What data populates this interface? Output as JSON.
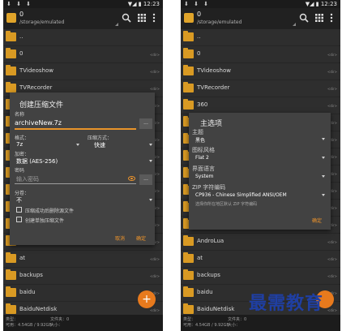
{
  "status": {
    "left_icons": "⬇ ⬇ ⬇",
    "right": "▼◢ ▮ 12:23"
  },
  "appbar": {
    "title": "0",
    "path": "/storage/emulated",
    "grid_glyph": "⋮⋮",
    "menu_glyph": "⋮"
  },
  "files": [
    {
      "name": "..",
      "tag": ""
    },
    {
      "name": "0",
      "tag": "<dir>"
    },
    {
      "name": "TVideoshow",
      "tag": "<dir>"
    },
    {
      "name": "TVRecorder",
      "tag": "<dir>"
    },
    {
      "name": "360",
      "tag": "<dir>"
    },
    {
      "name": "",
      "tag": "<dir>"
    },
    {
      "name": "",
      "tag": "<dir>"
    },
    {
      "name": "",
      "tag": "<dir>"
    },
    {
      "name": "",
      "tag": "<dir>"
    },
    {
      "name": "",
      "tag": "<dir>"
    },
    {
      "name": "",
      "tag": "<dir>"
    },
    {
      "name": "",
      "tag": "<dir>"
    },
    {
      "name": "AndroLua",
      "tag": "<dir>"
    },
    {
      "name": "at",
      "tag": "<dir>"
    },
    {
      "name": "backups",
      "tag": "<dir>"
    },
    {
      "name": "baidu",
      "tag": "<dir>"
    },
    {
      "name": "BaiduNetdisk",
      "tag": "<dir>"
    }
  ],
  "bottom": {
    "type_label": "类型：",
    "available": "可用：",
    "free": "4.54GB / 9.92GB",
    "folders": "文件夹：0",
    "size_label": "大小：",
    "files": "文件夹：0"
  },
  "create_dialog": {
    "title": "创建压缩文件",
    "name_label": "名称",
    "name_value": "archiveNew.7z",
    "browse": "...",
    "format_label": "格式：",
    "format_value": "7z",
    "method_label": "压缩方式：",
    "method_value": "快速",
    "encryption_label": "加密：",
    "encryption_value": "数据 (AES-256)",
    "password_label": "密码",
    "password_placeholder": "输入密码",
    "split_label": "分卷：",
    "split_value": "不",
    "delete_option": "压缩成功后删除源文件",
    "single_option": "创建单独压缩文件",
    "cancel": "取消",
    "ok": "确定"
  },
  "options_dialog": {
    "title": "主选项",
    "theme_label": "主题",
    "theme_value": "黑色",
    "icon_label": "图标风格",
    "icon_value": "Flat 2",
    "lang_label": "界面语言",
    "lang_value": "System",
    "zip_label": "ZIP 字符编码",
    "zip_value": "CP936 - Chinese Simplified ANSI/OEM",
    "zip_hint": "选择你所在地区默认 ZIP 字符编码",
    "ok": "确定"
  },
  "watermark": "最需教育",
  "colors": {
    "accent": "#e8942a",
    "folder": "#d99a23",
    "watermark": "#1f3fa3"
  }
}
